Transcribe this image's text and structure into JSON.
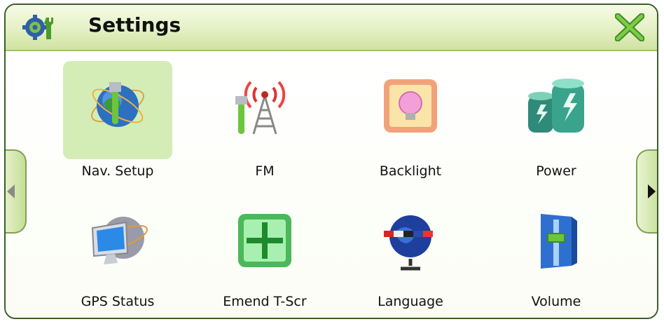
{
  "window": {
    "title": "Settings"
  },
  "icons": {
    "app": "settings-gear-wrench-icon",
    "close": "close-x-icon",
    "prev": "chevron-left-icon",
    "next": "chevron-right-icon"
  },
  "grid": {
    "items": [
      {
        "label": "Nav. Setup",
        "icon": "globe-wrench-icon",
        "selected": true
      },
      {
        "label": "FM",
        "icon": "radio-tower-icon",
        "selected": false
      },
      {
        "label": "Backlight",
        "icon": "lightbulb-icon",
        "selected": false
      },
      {
        "label": "Power",
        "icon": "battery-icon",
        "selected": false
      },
      {
        "label": "GPS Status",
        "icon": "monitor-globe-icon",
        "selected": false
      },
      {
        "label": "Emend T-Scr",
        "icon": "crosshair-screen-icon",
        "selected": false
      },
      {
        "label": "Language",
        "icon": "globe-flags-icon",
        "selected": false
      },
      {
        "label": "Volume",
        "icon": "volume-slider-icon",
        "selected": false
      }
    ]
  },
  "colors": {
    "accent": "#6fae3a",
    "selected_bg": "#d4edb6",
    "close": "#5fa52f"
  }
}
